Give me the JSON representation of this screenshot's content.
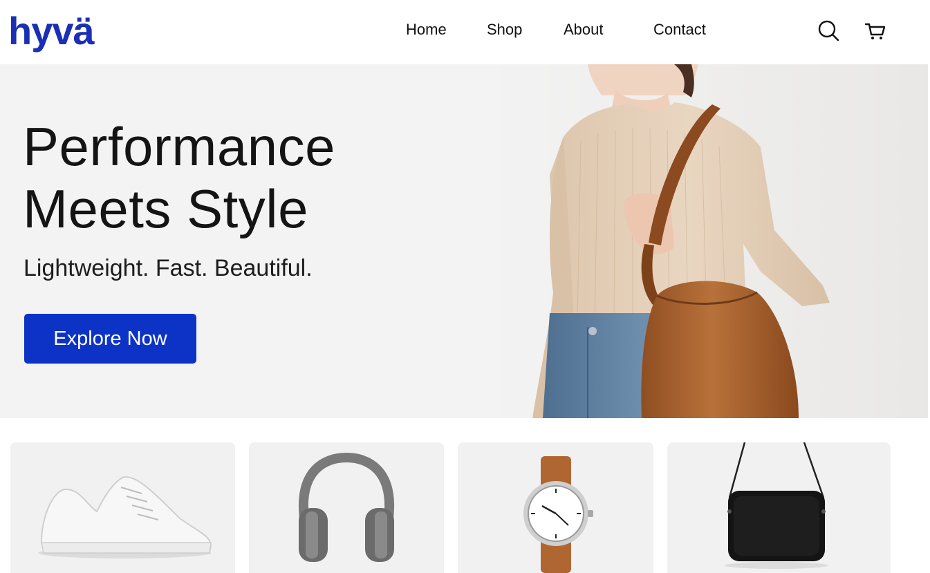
{
  "header": {
    "logo_text": "hyvä",
    "nav": [
      {
        "label": "Home"
      },
      {
        "label": "Shop"
      },
      {
        "label": "About"
      },
      {
        "label": "Contact"
      }
    ],
    "icons": [
      "search-icon",
      "cart-icon"
    ]
  },
  "hero": {
    "title_line1": "Performance",
    "title_line2": "Meets Style",
    "subtitle": "Lightweight. Fast. Beautiful.",
    "cta_label": "Explore Now",
    "image": "woman-with-brown-bucket-bag-photo"
  },
  "products": [
    {
      "image": "white-sneaker-photo"
    },
    {
      "image": "gray-headphones-photo"
    },
    {
      "image": "brown-strap-watch-photo"
    },
    {
      "image": "black-crossbody-bag-photo"
    }
  ],
  "colors": {
    "brand": "#1a2fb5",
    "cta": "#0d33c6",
    "hero_bg": "#f3f3f3",
    "card_bg": "#f1f1f2"
  }
}
